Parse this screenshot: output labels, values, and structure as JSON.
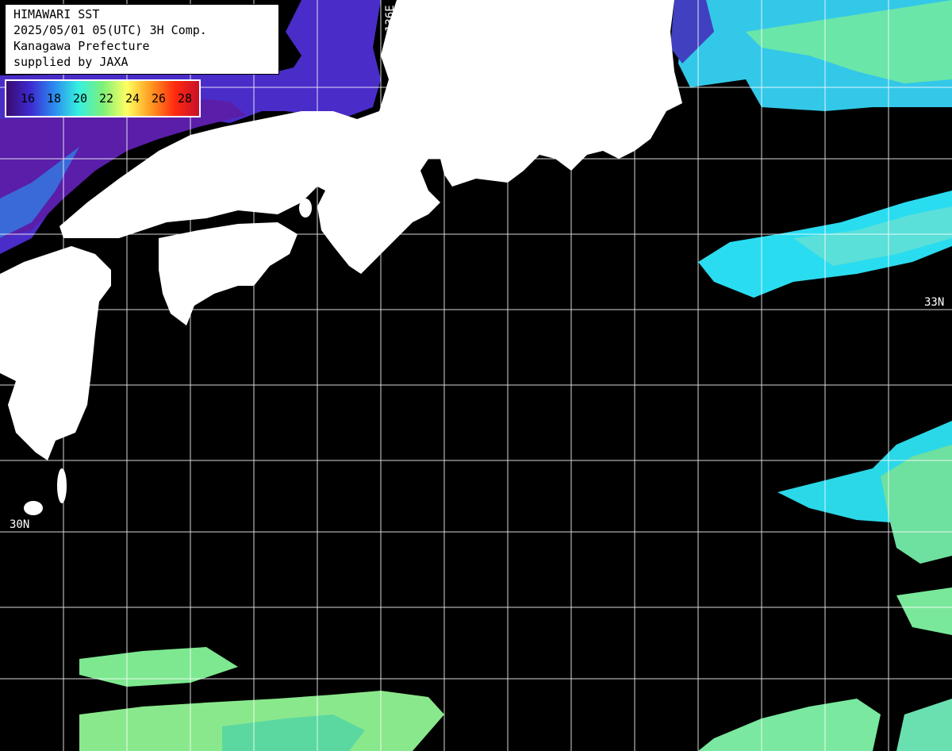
{
  "info": {
    "line1": "HIMAWARI SST",
    "line2": "2025/05/01 05(UTC) 3H Comp.",
    "line3": "Kanagawa Prefecture",
    "line4": "supplied by JAXA"
  },
  "legend": {
    "labels": [
      "16",
      "18",
      "20",
      "22",
      "24",
      "26",
      "28"
    ],
    "colors": [
      "#3a0a6e",
      "#3d2ad0",
      "#2b8cf0",
      "#35f0e0",
      "#7ef07a",
      "#ffff60",
      "#ff9a20",
      "#ff2a10",
      "#c8102a"
    ]
  },
  "grid": {
    "lat_labels": [
      {
        "text": "33N"
      },
      {
        "text": "33N"
      },
      {
        "text": "30N"
      }
    ],
    "lon_labels": [
      {
        "text": "136E"
      }
    ]
  },
  "colors": {
    "land": "#ffffff",
    "no_data": "#000000",
    "grid": "#ffffff"
  }
}
